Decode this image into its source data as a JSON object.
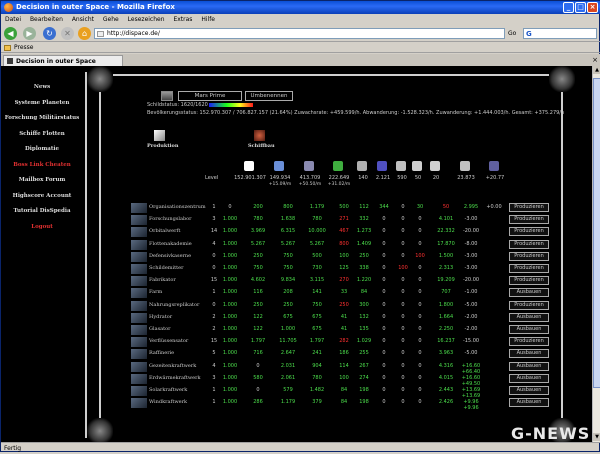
{
  "browser": {
    "title": "Decision in outer Space - Mozilla Firefox",
    "menu": [
      "Datei",
      "Bearbeiten",
      "Ansicht",
      "Gehe",
      "Lesezeichen",
      "Extras",
      "Hilfe"
    ],
    "url": "http://dispace.de/",
    "go_label": "Go",
    "search_logo": "G",
    "bookmark": "Presse",
    "tab_title": "Decision in outer Space",
    "status": "Fertig"
  },
  "sidebar": {
    "items": [
      {
        "label": "News",
        "color": "#dddddd"
      },
      {
        "label": "Systeme Planeten",
        "color": "#dddddd"
      },
      {
        "label": "Forschung Militärstatus",
        "color": "#dddddd"
      },
      {
        "label": "Schiffe Flotten",
        "color": "#dddddd"
      },
      {
        "label": "Diplomatie",
        "color": "#dddddd"
      },
      {
        "label": "Boss Link Cheaten",
        "color": "#e03030"
      },
      {
        "label": "Mailbox Forum",
        "color": "#dddddd"
      },
      {
        "label": "Highscore Account",
        "color": "#dddddd"
      },
      {
        "label": "Tutorial DisSpedia",
        "color": "#dddddd"
      },
      {
        "label": "Logout",
        "color": "#e03030"
      }
    ]
  },
  "planet": {
    "name": "Mars Prime",
    "rename_label": "Umbenennen",
    "shield_text": "Schildstatus: 1620/1620",
    "population_text": "Bevölkerungsstatus: 152.970.307 / 706.827.157 (21.64%) Zuwachsrate: +459.599/h. Abwanderung: -1.528.323/h. Zuwanderung: +1.444.003/h. Gesamt: +375.279/h"
  },
  "sections": {
    "production": "Produktion",
    "shipyard": "Schiffbau",
    "level": "Level"
  },
  "resources": {
    "values": [
      "152.901.307",
      "149.934",
      "413.709",
      "222.649",
      "140",
      "2.121",
      "590",
      "50",
      "20",
      "23.873",
      "+20.77"
    ],
    "rates": [
      "",
      "+15.09/m",
      "+50.50/m",
      "+31.02/m",
      "",
      "",
      "",
      "",
      "",
      "",
      ""
    ],
    "icon_colors": [
      "#ffffff",
      "#6a8fd8",
      "#8a8ab0",
      "#3fae3f",
      "#b0b0b0",
      "#5050c0",
      "#c0c0c0",
      "#cfcfcf",
      "#d0d0d0",
      "#c0c0c0",
      "#6060a0"
    ]
  },
  "buildings": [
    {
      "name": "Organisationszentrum",
      "level": "1",
      "cells": [
        [
          "0",
          "w"
        ],
        [
          "200",
          "g"
        ],
        [
          "800",
          "g"
        ],
        [
          "1.179",
          "g"
        ],
        [
          "500",
          "g"
        ],
        [
          "112",
          "g"
        ],
        [
          "344",
          "g"
        ],
        [
          "0",
          "w"
        ],
        [
          "30",
          "g"
        ],
        [
          "50",
          "r"
        ],
        [
          "2.995",
          "g"
        ],
        [
          "+0.00",
          "w"
        ]
      ],
      "button": "Produzieren"
    },
    {
      "name": "Forschungslabor",
      "level": "3",
      "cells": [
        [
          "1.000",
          "g"
        ],
        [
          "780",
          "g"
        ],
        [
          "1.638",
          "g"
        ],
        [
          "780",
          "g"
        ],
        [
          "271",
          "r"
        ],
        [
          "332",
          "g"
        ],
        [
          "0",
          "w"
        ],
        [
          "0",
          "w"
        ],
        [
          "0",
          "w"
        ],
        [
          "4.101",
          "g"
        ],
        [
          "-3.00",
          "w"
        ]
      ],
      "button": "Produzieren"
    },
    {
      "name": "Orbitalwerft",
      "level": "14",
      "cells": [
        [
          "1.000",
          "g"
        ],
        [
          "3.969",
          "g"
        ],
        [
          "6.315",
          "g"
        ],
        [
          "10.000",
          "g"
        ],
        [
          "467",
          "r"
        ],
        [
          "1.273",
          "g"
        ],
        [
          "0",
          "w"
        ],
        [
          "0",
          "w"
        ],
        [
          "0",
          "w"
        ],
        [
          "22.332",
          "g"
        ],
        [
          "-20.00",
          "w"
        ]
      ],
      "button": "Produzieren"
    },
    {
      "name": "Flottenakademie",
      "level": "4",
      "cells": [
        [
          "1.000",
          "g"
        ],
        [
          "5.267",
          "g"
        ],
        [
          "5.267",
          "g"
        ],
        [
          "5.267",
          "g"
        ],
        [
          "800",
          "r"
        ],
        [
          "1.409",
          "g"
        ],
        [
          "0",
          "w"
        ],
        [
          "0",
          "w"
        ],
        [
          "0",
          "w"
        ],
        [
          "17.870",
          "g"
        ],
        [
          "-8.00",
          "w"
        ]
      ],
      "button": "Produzieren"
    },
    {
      "name": "Defensivkaserne",
      "level": "0",
      "cells": [
        [
          "1.000",
          "g"
        ],
        [
          "250",
          "g"
        ],
        [
          "750",
          "g"
        ],
        [
          "500",
          "g"
        ],
        [
          "100",
          "g"
        ],
        [
          "250",
          "g"
        ],
        [
          "0",
          "w"
        ],
        [
          "0",
          "w"
        ],
        [
          "100",
          "r"
        ],
        [
          "1.500",
          "g"
        ],
        [
          "-3.00",
          "w"
        ]
      ],
      "button": "Produzieren"
    },
    {
      "name": "Schildemitter",
      "level": "0",
      "cells": [
        [
          "1.000",
          "g"
        ],
        [
          "750",
          "g"
        ],
        [
          "750",
          "g"
        ],
        [
          "730",
          "g"
        ],
        [
          "125",
          "g"
        ],
        [
          "338",
          "g"
        ],
        [
          "0",
          "w"
        ],
        [
          "100",
          "r"
        ],
        [
          "0",
          "w"
        ],
        [
          "2.313",
          "g"
        ],
        [
          "-3.00",
          "w"
        ]
      ],
      "button": "Produzieren"
    },
    {
      "name": "Fabrikator",
      "level": "15",
      "cells": [
        [
          "1.000",
          "g"
        ],
        [
          "4.602",
          "g"
        ],
        [
          "9.834",
          "g"
        ],
        [
          "3.115",
          "g"
        ],
        [
          "270",
          "r"
        ],
        [
          "1.220",
          "g"
        ],
        [
          "0",
          "w"
        ],
        [
          "0",
          "w"
        ],
        [
          "0",
          "w"
        ],
        [
          "19.209",
          "g"
        ],
        [
          "-20.00",
          "w"
        ]
      ],
      "button": "Produzieren"
    },
    {
      "name": "Farm",
      "level": "1",
      "cells": [
        [
          "1.000",
          "g"
        ],
        [
          "116",
          "g"
        ],
        [
          "208",
          "g"
        ],
        [
          "141",
          "g"
        ],
        [
          "33",
          "g"
        ],
        [
          "84",
          "g"
        ],
        [
          "0",
          "w"
        ],
        [
          "0",
          "w"
        ],
        [
          "0",
          "w"
        ],
        [
          "707",
          "g"
        ],
        [
          "-1.00",
          "w"
        ]
      ],
      "button": "Ausbauen"
    },
    {
      "name": "Nahrungsreplikator",
      "level": "0",
      "cells": [
        [
          "1.000",
          "g"
        ],
        [
          "250",
          "g"
        ],
        [
          "250",
          "g"
        ],
        [
          "750",
          "g"
        ],
        [
          "250",
          "r"
        ],
        [
          "300",
          "g"
        ],
        [
          "0",
          "w"
        ],
        [
          "0",
          "w"
        ],
        [
          "0",
          "w"
        ],
        [
          "1.800",
          "g"
        ],
        [
          "-5.00",
          "w"
        ]
      ],
      "button": "Produzieren"
    },
    {
      "name": "Hydrator",
      "level": "2",
      "cells": [
        [
          "1.000",
          "g"
        ],
        [
          "122",
          "g"
        ],
        [
          "675",
          "g"
        ],
        [
          "675",
          "g"
        ],
        [
          "41",
          "g"
        ],
        [
          "132",
          "g"
        ],
        [
          "0",
          "w"
        ],
        [
          "0",
          "w"
        ],
        [
          "0",
          "w"
        ],
        [
          "1.664",
          "g"
        ],
        [
          "-2.00",
          "w"
        ]
      ],
      "button": "Ausbauen"
    },
    {
      "name": "Glasator",
      "level": "2",
      "cells": [
        [
          "1.000",
          "g"
        ],
        [
          "122",
          "g"
        ],
        [
          "1.000",
          "g"
        ],
        [
          "675",
          "g"
        ],
        [
          "41",
          "g"
        ],
        [
          "135",
          "g"
        ],
        [
          "0",
          "w"
        ],
        [
          "0",
          "w"
        ],
        [
          "0",
          "w"
        ],
        [
          "2.250",
          "g"
        ],
        [
          "-2.00",
          "w"
        ]
      ],
      "button": "Ausbauen"
    },
    {
      "name": "Verflüssensator",
      "level": "15",
      "cells": [
        [
          "1.000",
          "g"
        ],
        [
          "1.797",
          "g"
        ],
        [
          "11.705",
          "g"
        ],
        [
          "1.797",
          "g"
        ],
        [
          "282",
          "r"
        ],
        [
          "1.029",
          "g"
        ],
        [
          "0",
          "w"
        ],
        [
          "0",
          "w"
        ],
        [
          "0",
          "w"
        ],
        [
          "16.237",
          "g"
        ],
        [
          "-15.00",
          "w"
        ]
      ],
      "button": "Produzieren"
    },
    {
      "name": "Raffinerie",
      "level": "5",
      "cells": [
        [
          "1.000",
          "g"
        ],
        [
          "716",
          "g"
        ],
        [
          "2.647",
          "g"
        ],
        [
          "241",
          "g"
        ],
        [
          "186",
          "g"
        ],
        [
          "255",
          "g"
        ],
        [
          "0",
          "w"
        ],
        [
          "0",
          "w"
        ],
        [
          "0",
          "w"
        ],
        [
          "3.963",
          "g"
        ],
        [
          "-5.00",
          "w"
        ]
      ],
      "button": "Ausbauen"
    },
    {
      "name": "Gezeitenkraftwerk",
      "level": "4",
      "cells": [
        [
          "1.000",
          "g"
        ],
        [
          "0",
          "w"
        ],
        [
          "2.031",
          "g"
        ],
        [
          "904",
          "g"
        ],
        [
          "114",
          "g"
        ],
        [
          "267",
          "g"
        ],
        [
          "0",
          "w"
        ],
        [
          "0",
          "w"
        ],
        [
          "0",
          "w"
        ],
        [
          "4.316",
          "g"
        ],
        [
          "+16.60 +66.40",
          "g"
        ]
      ],
      "button": "Ausbauen"
    },
    {
      "name": "Erdwärmekraftwerk",
      "level": "3",
      "cells": [
        [
          "1.000",
          "g"
        ],
        [
          "580",
          "g"
        ],
        [
          "2.061",
          "g"
        ],
        [
          "780",
          "g"
        ],
        [
          "100",
          "g"
        ],
        [
          "274",
          "g"
        ],
        [
          "0",
          "w"
        ],
        [
          "0",
          "w"
        ],
        [
          "0",
          "w"
        ],
        [
          "4.015",
          "g"
        ],
        [
          "+16.60 +49.50",
          "g"
        ]
      ],
      "button": "Ausbauen"
    },
    {
      "name": "Solarkraftwerk",
      "level": "1",
      "cells": [
        [
          "1.000",
          "g"
        ],
        [
          "0",
          "w"
        ],
        [
          "579",
          "g"
        ],
        [
          "1.482",
          "g"
        ],
        [
          "84",
          "g"
        ],
        [
          "198",
          "g"
        ],
        [
          "0",
          "w"
        ],
        [
          "0",
          "w"
        ],
        [
          "0",
          "w"
        ],
        [
          "2.443",
          "g"
        ],
        [
          "+13.69 +13.69",
          "g"
        ]
      ],
      "button": "Ausbauen"
    },
    {
      "name": "Windkraftwerk",
      "level": "1",
      "cells": [
        [
          "1.000",
          "g"
        ],
        [
          "286",
          "g"
        ],
        [
          "1.179",
          "g"
        ],
        [
          "379",
          "g"
        ],
        [
          "84",
          "g"
        ],
        [
          "198",
          "g"
        ],
        [
          "0",
          "w"
        ],
        [
          "0",
          "w"
        ],
        [
          "0",
          "w"
        ],
        [
          "2.426",
          "g"
        ],
        [
          "+9.96 +9.96",
          "g"
        ]
      ],
      "button": "Ausbauen"
    }
  ],
  "watermark": "G-NEWS"
}
